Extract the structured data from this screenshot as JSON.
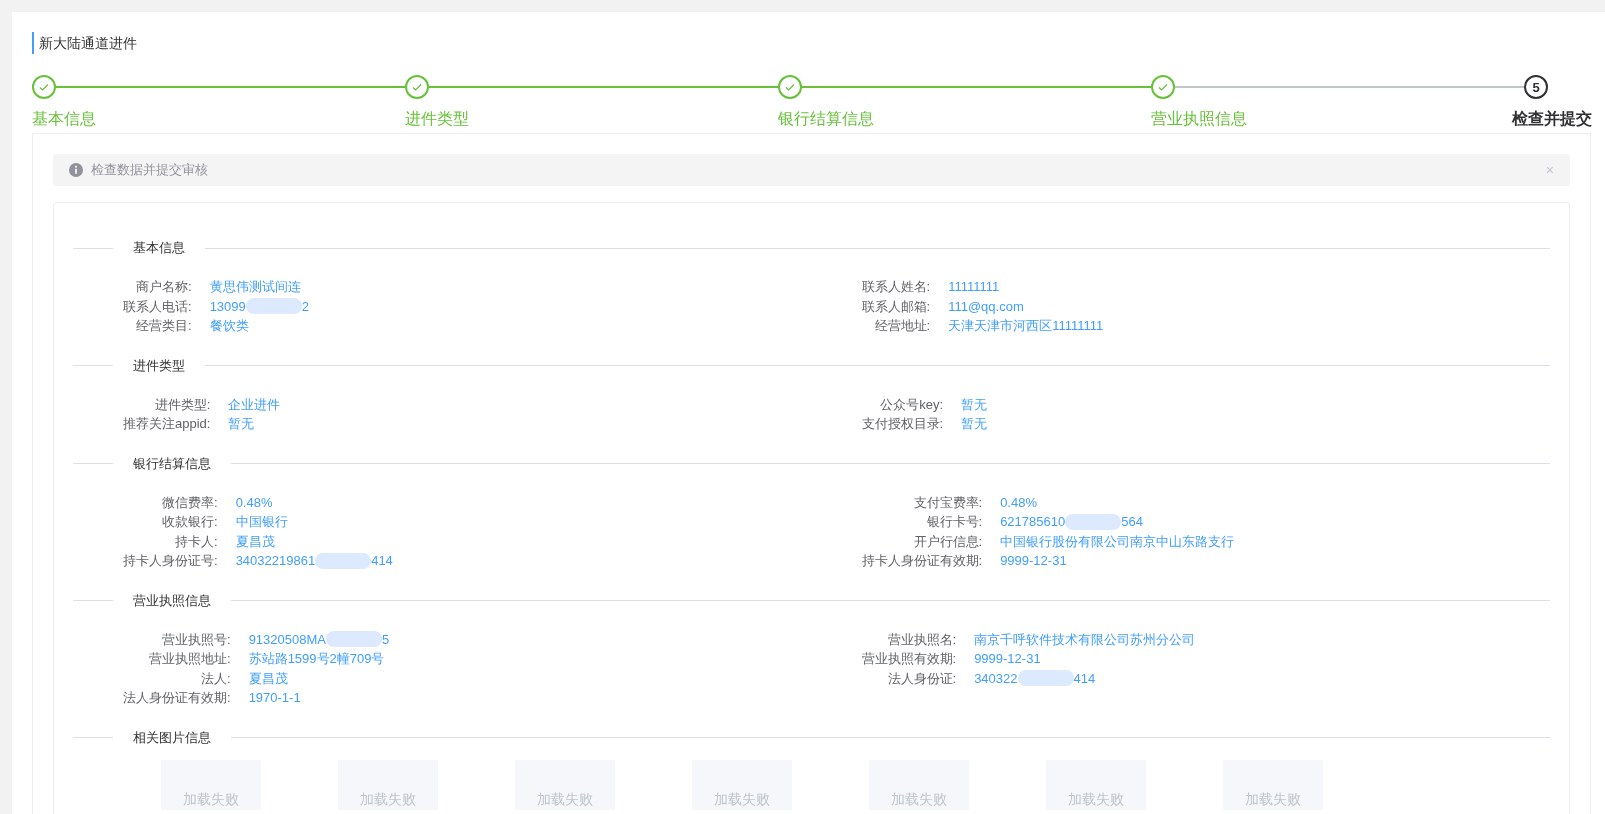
{
  "page": {
    "title": "新大陆通道进件"
  },
  "steps": [
    {
      "label": "基本信息",
      "done": true
    },
    {
      "label": "进件类型",
      "done": true
    },
    {
      "label": "银行结算信息",
      "done": true
    },
    {
      "label": "营业执照信息",
      "done": true
    },
    {
      "label": "检查并提交",
      "done": false,
      "number": "5"
    }
  ],
  "alert": {
    "text": "检查数据并提交审核",
    "close": "×"
  },
  "sections": [
    {
      "title": "基本信息",
      "left": [
        {
          "label": "商户名称:",
          "value": "黄思伟测试间连"
        },
        {
          "label": "联系人电话:",
          "value": "13099",
          "masked": true,
          "tail": "2"
        },
        {
          "label": "经营类目:",
          "value": "餐饮类"
        }
      ],
      "right": [
        {
          "label": "联系人姓名:",
          "value": "11111111"
        },
        {
          "label": "联系人邮箱:",
          "value": "111@qq.com"
        },
        {
          "label": "经营地址:",
          "value": "天津天津市河西区11111111"
        }
      ]
    },
    {
      "title": "进件类型",
      "left": [
        {
          "label": "进件类型:",
          "value": "企业进件"
        },
        {
          "label": "推荐关注appid:",
          "value": "暂无"
        }
      ],
      "right": [
        {
          "label": "公众号key:",
          "value": "暂无"
        },
        {
          "label": "支付授权目录:",
          "value": "暂无"
        }
      ]
    },
    {
      "title": "银行结算信息",
      "left": [
        {
          "label": "微信费率:",
          "value": "0.48%"
        },
        {
          "label": "收款银行:",
          "value": "中国银行"
        },
        {
          "label": "持卡人:",
          "value": "夏昌茂"
        },
        {
          "label": "持卡人身份证号:",
          "value": "34032219861",
          "masked": true,
          "tail": "414"
        }
      ],
      "right": [
        {
          "label": "支付宝费率:",
          "value": "0.48%"
        },
        {
          "label": "银行卡号:",
          "value": "621785610",
          "masked": true,
          "tail": "564"
        },
        {
          "label": "开户行信息:",
          "value": "中国银行股份有限公司南京中山东路支行"
        },
        {
          "label": "持卡人身份证有效期:",
          "value": "9999-12-31"
        }
      ]
    },
    {
      "title": "营业执照信息",
      "left": [
        {
          "label": "营业执照号:",
          "value": "91320508MA",
          "masked": true,
          "tail": "5"
        },
        {
          "label": "营业执照地址:",
          "value": "苏站路1599号2幢709号"
        },
        {
          "label": "法人:",
          "value": "夏昌茂"
        },
        {
          "label": "法人身份证有效期:",
          "value": "1970-1-1"
        }
      ],
      "right": [
        {
          "label": "营业执照名:",
          "value": "南京千呼软件技术有限公司苏州分公司"
        },
        {
          "label": "营业执照有效期:",
          "value": "9999-12-31"
        },
        {
          "label": "法人身份证:",
          "value": "340322",
          "masked": true,
          "tail": "414"
        }
      ]
    },
    {
      "title": "相关图片信息",
      "images": [
        "加载失败",
        "加载失败",
        "加载失败",
        "加载失败",
        "加载失败",
        "加载失败",
        "加载失败"
      ]
    }
  ]
}
